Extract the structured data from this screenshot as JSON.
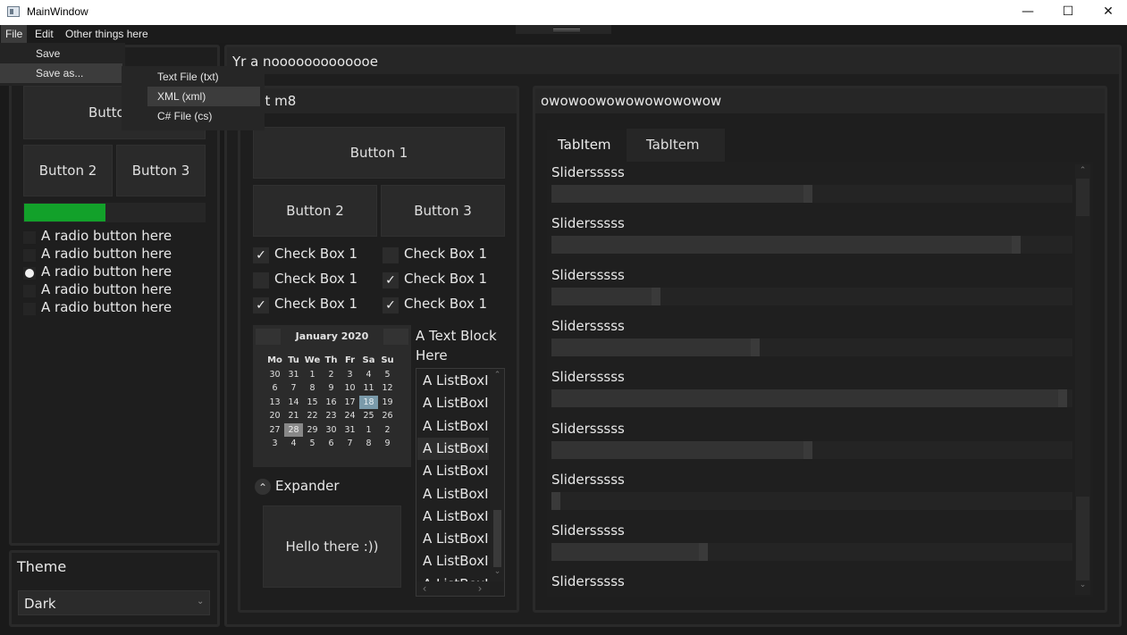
{
  "window": {
    "title": "MainWindow",
    "minimize_glyph": "—",
    "maximize_glyph": "☐",
    "close_glyph": "✕"
  },
  "menubar": {
    "items": [
      "File",
      "Edit",
      "Other things here"
    ]
  },
  "file_menu": {
    "items": [
      "Save",
      "Save as..."
    ]
  },
  "save_as_submenu": {
    "items": [
      "Text File (txt)",
      "XML (xml)",
      "C# File (cs)"
    ]
  },
  "left_panel": {
    "button1": "Button 1",
    "button1_visible": "Butto",
    "button2": "Button 2",
    "button3": "Button 3",
    "progress_value": 0.45,
    "progress_color": "#12a12a",
    "radios": [
      {
        "label": "A radio button here",
        "checked": false
      },
      {
        "label": "A radio button here",
        "checked": false
      },
      {
        "label": "A radio button here",
        "checked": true
      },
      {
        "label": "A radio button here",
        "checked": false
      },
      {
        "label": "A radio button here",
        "checked": false
      }
    ]
  },
  "theme": {
    "title": "Theme",
    "selected": "Dark"
  },
  "outer_group": {
    "header": "Yr a nooooooooooooe"
  },
  "middle_group": {
    "header": "wot m8",
    "button1": "Button 1",
    "button2": "Button 2",
    "button3": "Button 3",
    "checkboxes": [
      {
        "label": "Check Box 1",
        "checked": true
      },
      {
        "label": "Check Box 1",
        "checked": false
      },
      {
        "label": "Check Box 1",
        "checked": false
      },
      {
        "label": "Check Box 1",
        "checked": true
      },
      {
        "label": "Check Box 1",
        "checked": true
      },
      {
        "label": "Check Box 1",
        "checked": true
      }
    ],
    "check_glyph": "✓",
    "text_block_line1": "A Text Block",
    "text_block_line2": "Here",
    "expander_label": "Expander",
    "expander_glyph": "⌃",
    "expander_content": "Hello there :))"
  },
  "calendar": {
    "month": "January 2020",
    "weekdays": [
      "Mo",
      "Tu",
      "We",
      "Th",
      "Fr",
      "Sa",
      "Su"
    ],
    "weeks": [
      [
        "30",
        "31",
        "1",
        "2",
        "3",
        "4",
        "5"
      ],
      [
        "6",
        "7",
        "8",
        "9",
        "10",
        "11",
        "12"
      ],
      [
        "13",
        "14",
        "15",
        "16",
        "17",
        "18",
        "19"
      ],
      [
        "20",
        "21",
        "22",
        "23",
        "24",
        "25",
        "26"
      ],
      [
        "27",
        "28",
        "29",
        "30",
        "31",
        "1",
        "2"
      ],
      [
        "3",
        "4",
        "5",
        "6",
        "7",
        "8",
        "9"
      ]
    ],
    "selected_day": "18",
    "today_day": "28"
  },
  "listbox": {
    "items": [
      "A ListBoxIt",
      "A ListBoxIt",
      "A ListBoxIt",
      "A ListBoxIt",
      "A ListBoxIt",
      "A ListBoxIt",
      "A ListBoxIt",
      "A ListBoxIt",
      "A ListBoxIt",
      "A ListBoxIt"
    ],
    "up_glyph": "⌃",
    "down_glyph": "⌄",
    "left_glyph": "‹",
    "right_glyph": "›"
  },
  "right_group": {
    "header": "owowoowowowowowowow",
    "tabs": [
      "TabItem",
      "TabItem"
    ],
    "sliders": [
      {
        "label": "Slidersssss",
        "value": 0.5
      },
      {
        "label": "Slidersssss",
        "value": 0.9
      },
      {
        "label": "Slidersssss",
        "value": 0.21
      },
      {
        "label": "Slidersssss",
        "value": 0.4
      },
      {
        "label": "Slidersssss",
        "value": 0.99
      },
      {
        "label": "Slidersssss",
        "value": 0.5
      },
      {
        "label": "Slidersssss",
        "value": 0.01
      },
      {
        "label": "Slidersssss",
        "value": 0.3
      },
      {
        "label": "Slidersssss",
        "value": 0.0
      }
    ],
    "scroll_up_glyph": "⌃",
    "scroll_down_glyph": "⌄"
  }
}
